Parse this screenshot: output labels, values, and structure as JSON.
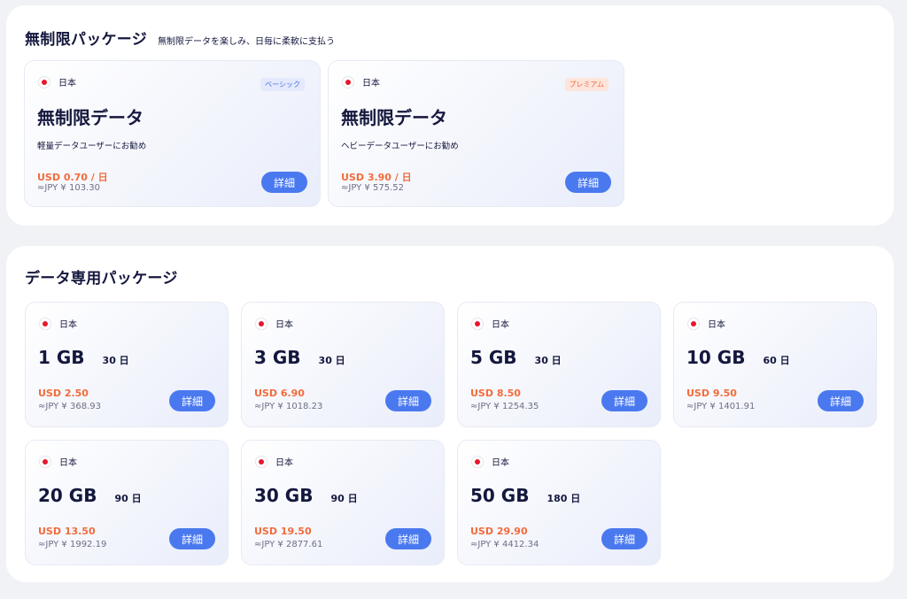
{
  "unlimited_section": {
    "title": "無制限パッケージ",
    "subtitle": "無制限データを楽しみ、日毎に柔軟に支払う",
    "cards": [
      {
        "country": "日本",
        "badge": "ベーシック",
        "title": "無制限データ",
        "description": "軽量データユーザーにお勧め",
        "price": "USD 0.70 / 日",
        "jpy": "≈JPY ¥  103.30",
        "button": "詳細"
      },
      {
        "country": "日本",
        "badge": "プレミアム",
        "title": "無制限データ",
        "description": "ヘビーデータユーザーにお勧め",
        "price": "USD 3.90 / 日",
        "jpy": "≈JPY ¥  575.52",
        "button": "詳細"
      }
    ]
  },
  "data_section": {
    "title": "データ専用パッケージ",
    "cards": [
      {
        "country": "日本",
        "gb": "1 GB",
        "days": "30 日",
        "price": "USD 2.50",
        "jpy": "≈JPY ¥  368.93",
        "button": "詳細"
      },
      {
        "country": "日本",
        "gb": "3 GB",
        "days": "30 日",
        "price": "USD 6.90",
        "jpy": "≈JPY ¥  1018.23",
        "button": "詳細"
      },
      {
        "country": "日本",
        "gb": "5 GB",
        "days": "30 日",
        "price": "USD 8.50",
        "jpy": "≈JPY ¥  1254.35",
        "button": "詳細"
      },
      {
        "country": "日本",
        "gb": "10 GB",
        "days": "60 日",
        "price": "USD 9.50",
        "jpy": "≈JPY ¥  1401.91",
        "button": "詳細"
      },
      {
        "country": "日本",
        "gb": "20 GB",
        "days": "90 日",
        "price": "USD 13.50",
        "jpy": "≈JPY ¥  1992.19",
        "button": "詳細"
      },
      {
        "country": "日本",
        "gb": "30 GB",
        "days": "90 日",
        "price": "USD 19.50",
        "jpy": "≈JPY ¥  2877.61",
        "button": "詳細"
      },
      {
        "country": "日本",
        "gb": "50 GB",
        "days": "180 日",
        "price": "USD 29.90",
        "jpy": "≈JPY ¥  4412.34",
        "button": "詳細"
      }
    ]
  },
  "colors": {
    "accent": "#4a79ef",
    "price": "#f36b3b",
    "text": "#14173d",
    "flag_red": "#e8172c"
  },
  "icons": {
    "flag": "japan-flag-icon"
  }
}
